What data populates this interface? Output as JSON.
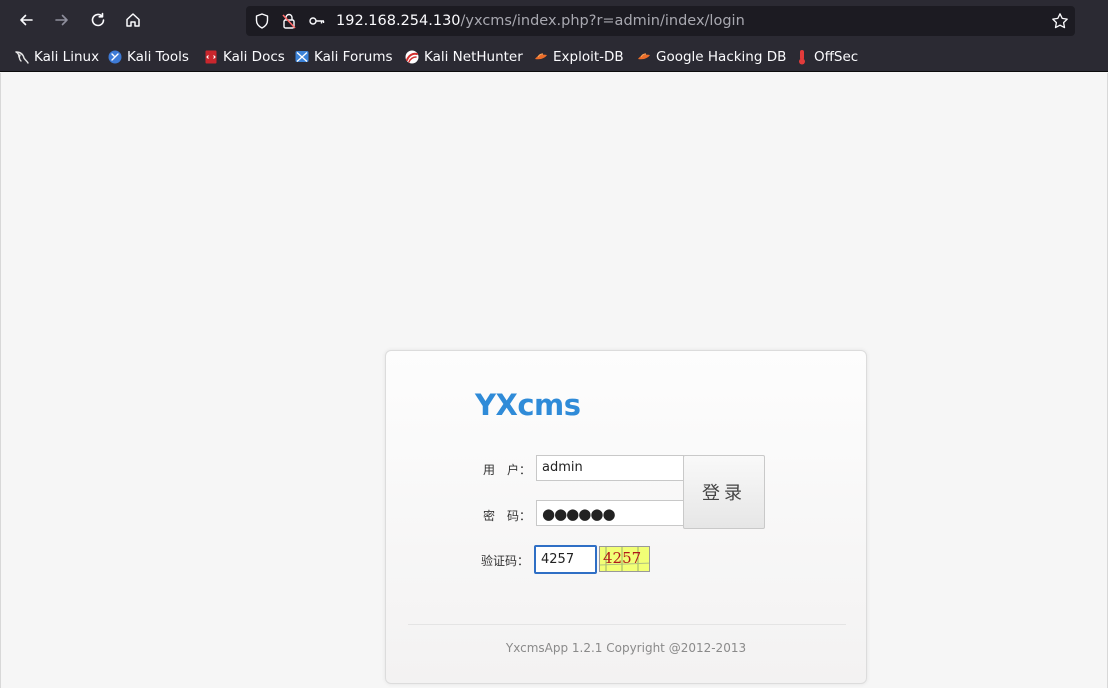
{
  "browser": {
    "url_host": "192.168.254.130",
    "url_path": "/yxcms/index.php?r=admin/index/login",
    "bookmarks": [
      {
        "label": "Kali Linux",
        "icon": "kali-dragon-icon"
      },
      {
        "label": "Kali Tools",
        "icon": "kali-tools-icon"
      },
      {
        "label": "Kali Docs",
        "icon": "kali-docs-icon"
      },
      {
        "label": "Kali Forums",
        "icon": "kali-forums-icon"
      },
      {
        "label": "Kali NetHunter",
        "icon": "kali-nethunter-icon"
      },
      {
        "label": "Exploit-DB",
        "icon": "exploit-db-icon"
      },
      {
        "label": "Google Hacking DB",
        "icon": "ghdb-icon"
      },
      {
        "label": "OffSec",
        "icon": "offsec-icon"
      }
    ]
  },
  "login": {
    "logo": "YXcms",
    "username_label": "用　户：",
    "username_value": "admin",
    "password_label": "密　码：",
    "password_value": "●●●●●●",
    "captcha_label": "验证码：",
    "captcha_value": "4257",
    "captcha_image_text": "4257",
    "submit_label": "登录",
    "copyright": "YxcmsApp 1.2.1 Copyright @2012-2013"
  },
  "colors": {
    "accent": "#2f8bd8",
    "captcha_bg": "#f2ff76",
    "captcha_text": "#b01919",
    "focus_border": "#2f6fc5"
  }
}
